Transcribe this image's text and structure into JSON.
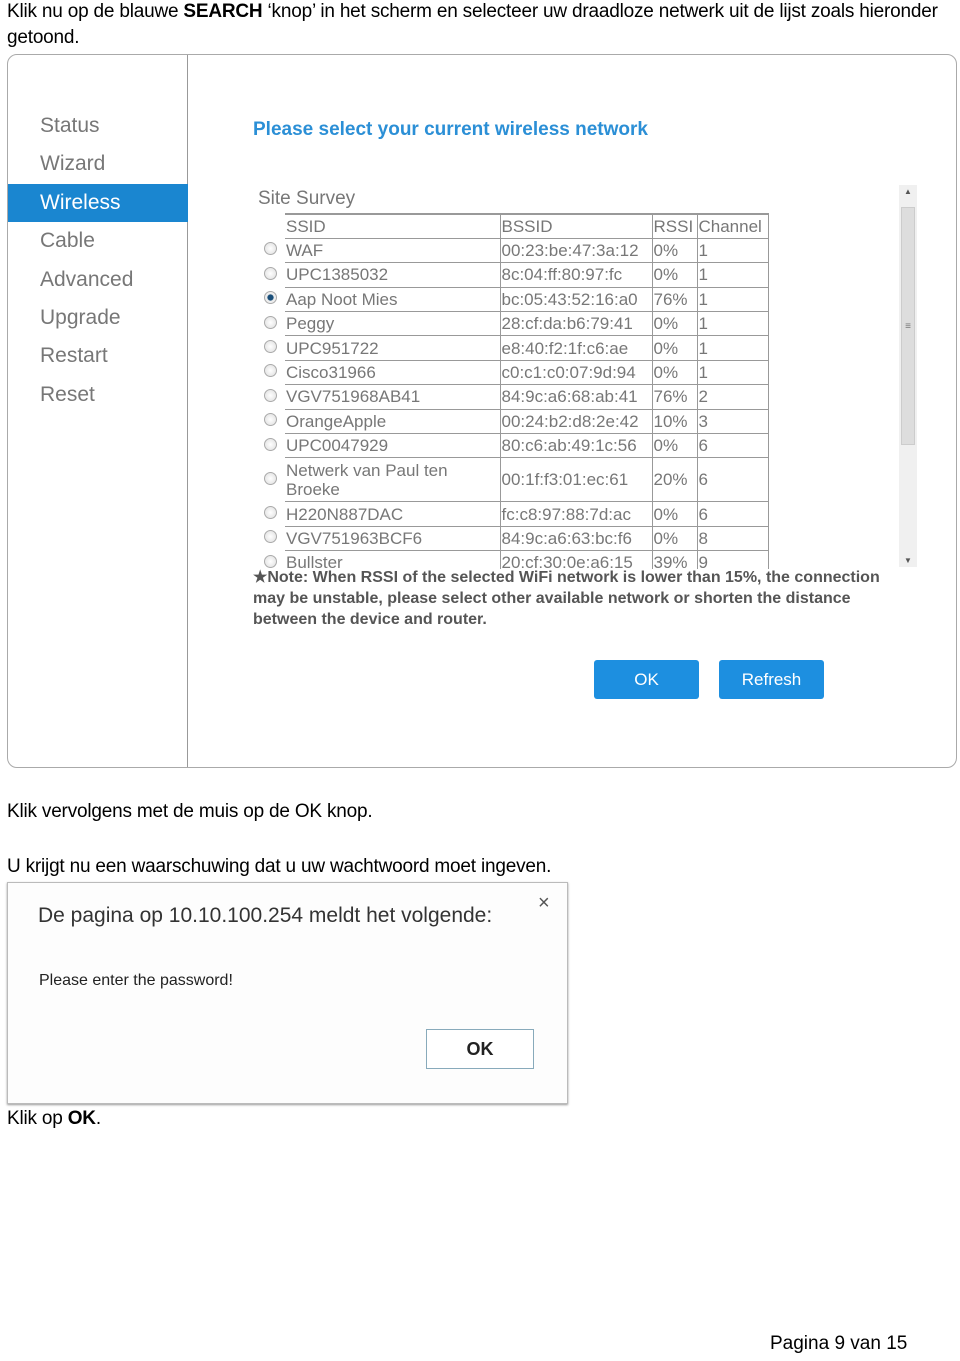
{
  "intro": {
    "before": "Klik nu op de blauwe ",
    "bold": "SEARCH",
    "after": " ‘knop’ in het scherm en selecteer uw draadloze netwerk uit de lijst zoals hieronder getoond."
  },
  "router": {
    "menu": [
      "Status",
      "Wizard",
      "Wireless",
      "Cable",
      "Advanced",
      "Upgrade",
      "Restart",
      "Reset"
    ],
    "active_menu": "Wireless",
    "accent": "#1a86d0",
    "title": "Please select your current wireless network",
    "survey_label": "Site Survey",
    "columns": [
      "SSID",
      "BSSID",
      "RSSI",
      "Channel"
    ],
    "rows": [
      {
        "ssid": "WAF",
        "bssid": "00:23:be:47:3a:12",
        "rssi": "0%",
        "channel": "1",
        "selected": false
      },
      {
        "ssid": "UPC1385032",
        "bssid": "8c:04:ff:80:97:fc",
        "rssi": "0%",
        "channel": "1",
        "selected": false
      },
      {
        "ssid": "Aap Noot Mies",
        "bssid": "bc:05:43:52:16:a0",
        "rssi": "76%",
        "channel": "1",
        "selected": true
      },
      {
        "ssid": "Peggy",
        "bssid": "28:cf:da:b6:79:41",
        "rssi": "0%",
        "channel": "1",
        "selected": false
      },
      {
        "ssid": "UPC951722",
        "bssid": "e8:40:f2:1f:c6:ae",
        "rssi": "0%",
        "channel": "1",
        "selected": false
      },
      {
        "ssid": "Cisco31966",
        "bssid": "c0:c1:c0:07:9d:94",
        "rssi": "0%",
        "channel": "1",
        "selected": false
      },
      {
        "ssid": "VGV751968AB41",
        "bssid": "84:9c:a6:68:ab:41",
        "rssi": "76%",
        "channel": "2",
        "selected": false
      },
      {
        "ssid": "OrangeApple",
        "bssid": "00:24:b2:d8:2e:42",
        "rssi": "10%",
        "channel": "3",
        "selected": false
      },
      {
        "ssid": "UPC0047929",
        "bssid": "80:c6:ab:49:1c:56",
        "rssi": "0%",
        "channel": "6",
        "selected": false
      },
      {
        "ssid": "Netwerk van Paul ten Broeke",
        "bssid": "00:1f:f3:01:ec:61",
        "rssi": "20%",
        "channel": "6",
        "selected": false
      },
      {
        "ssid": "H220N887DAC",
        "bssid": "fc:c8:97:88:7d:ac",
        "rssi": "0%",
        "channel": "6",
        "selected": false
      },
      {
        "ssid": "VGV751963BCF6",
        "bssid": "84:9c:a6:63:bc:f6",
        "rssi": "0%",
        "channel": "8",
        "selected": false
      },
      {
        "ssid": "Bullster",
        "bssid": "20:cf:30:0e:a6:15",
        "rssi": "39%",
        "channel": "9",
        "selected": false
      }
    ],
    "note": "★Note: When RSSI of the selected WiFi network is lower than 15%, the connection may be unstable, please select other available network or shorten the distance between the device and router.",
    "ok_label": "OK",
    "refresh_label": "Refresh"
  },
  "step2": "Klik vervolgens met de muis op de OK knop.",
  "step3": "U krijgt nu een waarschuwing dat u uw wachtwoord moet ingeven.",
  "dialog": {
    "title": "De pagina op 10.10.100.254 meldt het volgende:",
    "close": "×",
    "message": "Please enter the password!",
    "ok_label": "OK"
  },
  "step4": {
    "before": "Klik op ",
    "bold": "OK",
    "after": "."
  },
  "footer": "Pagina 9 van 15"
}
